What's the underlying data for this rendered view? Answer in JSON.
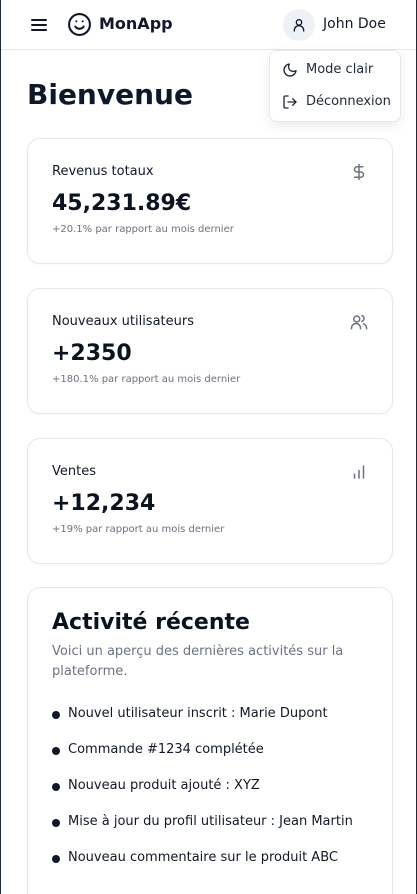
{
  "header": {
    "brand": "MonApp",
    "user_name": "John Doe",
    "icons": {
      "menu": "hamburger-icon",
      "logo": "smiley-icon",
      "user": "user-icon"
    }
  },
  "user_menu": {
    "items": [
      {
        "label": "Mode clair",
        "icon": "moon-icon"
      },
      {
        "label": "Déconnexion",
        "icon": "logout-icon"
      }
    ]
  },
  "page": {
    "title": "Bienvenue"
  },
  "stats": [
    {
      "label": "Revenus totaux",
      "value": "45,231.89€",
      "sub": "+20.1% par rapport au mois dernier",
      "icon": "dollar-icon"
    },
    {
      "label": "Nouveaux utilisateurs",
      "value": "+2350",
      "sub": "+180.1% par rapport au mois dernier",
      "icon": "users-icon"
    },
    {
      "label": "Ventes",
      "value": "+12,234",
      "sub": "+19% par rapport au mois dernier",
      "icon": "bar-chart-icon"
    }
  ],
  "activity": {
    "title": "Activité récente",
    "description": "Voici un aperçu des dernières activités sur la plateforme.",
    "items": [
      "Nouvel utilisateur inscrit : Marie Dupont",
      "Commande #1234 complétée",
      "Nouveau produit ajouté : XYZ",
      "Mise à jour du profil utilisateur : Jean Martin",
      "Nouveau commentaire sur le produit ABC"
    ]
  },
  "colors": {
    "text": "#0f172a",
    "muted": "#6b7280",
    "border": "#e5e7eb",
    "icon_muted": "#6b7280"
  }
}
